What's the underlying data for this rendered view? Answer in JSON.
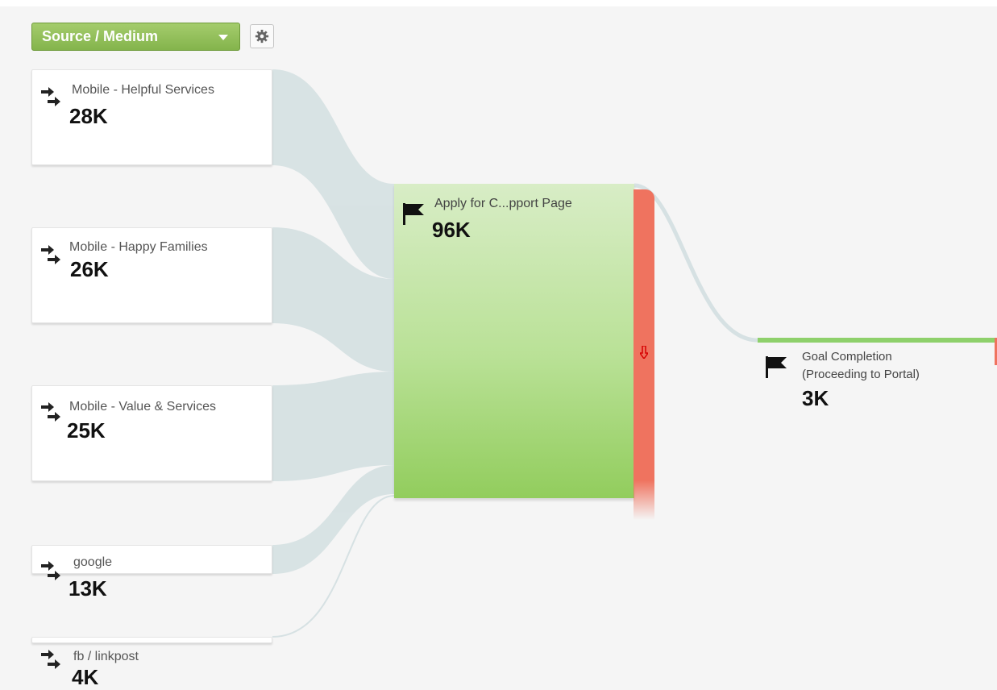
{
  "dimension_selector": {
    "label": "Source / Medium"
  },
  "settings_button": {
    "icon": "gear-icon"
  },
  "sources": [
    {
      "label": "Mobile - Helpful Services",
      "value": "28K",
      "icon": "entry-arrows-icon"
    },
    {
      "label": "Mobile - Happy Families",
      "value": "26K",
      "icon": "entry-arrows-icon"
    },
    {
      "label": "Mobile - Value & Services",
      "value": "25K",
      "icon": "entry-arrows-icon"
    },
    {
      "label": "google",
      "value": "13K",
      "icon": "entry-arrows-icon"
    },
    {
      "label": "fb / linkpost",
      "value": "4K",
      "icon": "entry-arrows-icon"
    }
  ],
  "step": {
    "label": "Apply for C...pport Page",
    "value": "96K",
    "icon": "flag-icon"
  },
  "dropoff": {
    "icon": "down-arrow-icon"
  },
  "goal": {
    "line1": "Goal Completion",
    "line2": "(Proceeding to Portal)",
    "value": "3K",
    "icon": "flag-icon"
  },
  "colors": {
    "selector_green": "#93c05a",
    "step_green": "#a8d886",
    "dropoff_red": "#ef735f",
    "flow_gray": "#d6e1e3"
  }
}
